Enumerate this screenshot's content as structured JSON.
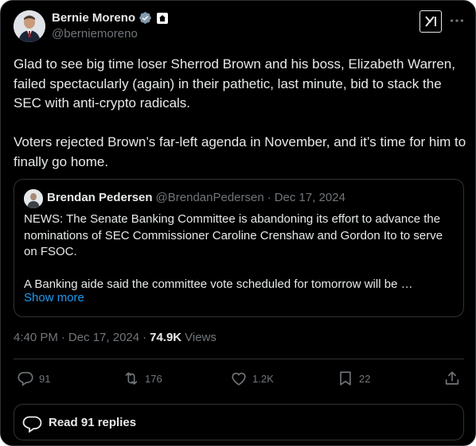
{
  "author": {
    "display_name": "Bernie Moreno",
    "handle": "@berniemoreno"
  },
  "tweet": {
    "text": "Glad to see big time loser Sherrod Brown and his boss, Elizabeth Warren, failed spectacularly (again) in their pathetic, last minute, bid to stack the SEC with anti-crypto radicals.\n\nVoters rejected Brown’s far-left agenda in November, and it’s time for him to finally go home."
  },
  "quote": {
    "display_name": "Brendan Pedersen",
    "handle": "@BrendanPedersen",
    "separator": "·",
    "date": "Dec 17, 2024",
    "text": "NEWS: The Senate Banking Committee is abandoning its effort to advance the nominations of SEC Commissioner Caroline Crenshaw and Gordon Ito to serve on FSOC.\n\nA Banking aide said the committee vote scheduled for tomorrow will be …",
    "show_more": "Show more"
  },
  "meta": {
    "time": "4:40 PM",
    "dot1": "·",
    "date": "Dec 17, 2024",
    "dot2": "·",
    "views_count": "74.9K",
    "views_label": "Views"
  },
  "actions": {
    "replies": "91",
    "reposts": "176",
    "likes": "1.2K",
    "bookmarks": "22"
  },
  "read_replies": {
    "label": "Read 91 replies"
  },
  "colors": {
    "background": "#000000",
    "text": "#e7e9ea",
    "secondary": "#71767b",
    "link": "#1d9bf0",
    "border": "#2f3336"
  }
}
